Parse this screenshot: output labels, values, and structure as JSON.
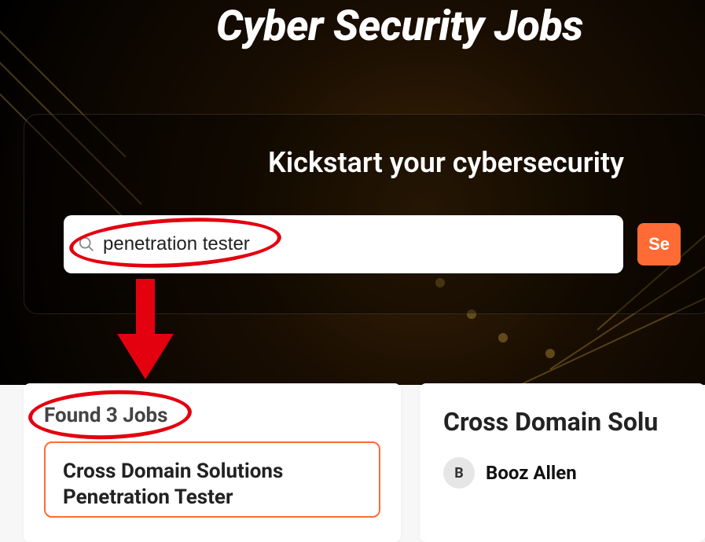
{
  "hero": {
    "title": "Cyber Security Jobs",
    "subtitle": "Kickstart your cybersecurity"
  },
  "search": {
    "value": "penetration tester",
    "button_label": "Se"
  },
  "results": {
    "found_label": "Found 3 Jobs",
    "jobs": [
      {
        "title": "Cross Domain Solutions Penetration Tester"
      }
    ]
  },
  "detail": {
    "title": "Cross Domain Solu",
    "company": {
      "initial": "B",
      "name": "Booz Allen"
    }
  },
  "icons": {
    "search": "search-icon"
  },
  "colors": {
    "accent": "#ff6b35",
    "annotation": "#e3000f"
  }
}
